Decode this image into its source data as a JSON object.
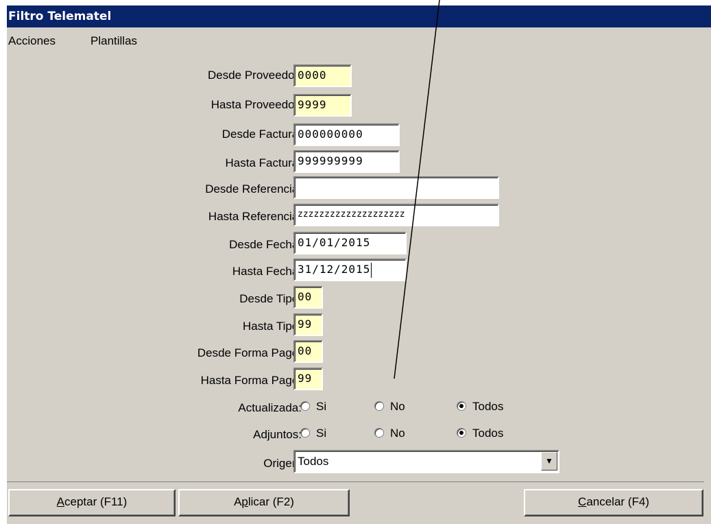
{
  "window": {
    "title": "Filtro Telematel"
  },
  "menu": {
    "items": [
      "Acciones",
      "Plantillas"
    ]
  },
  "form": {
    "fields": [
      {
        "label": "Desde Proveedor:",
        "value": "0000"
      },
      {
        "label": "Hasta Proveedor:",
        "value": "9999"
      },
      {
        "label": "Desde Factura:",
        "value": "000000000"
      },
      {
        "label": "Hasta Factura:",
        "value": "999999999"
      },
      {
        "label": "Desde Referencia:",
        "value": ""
      },
      {
        "label": "Hasta Referencia:",
        "value": "zzzzzzzzzzzzzzzzzzzz"
      },
      {
        "label": "Desde Fecha:",
        "value": "01/01/2015"
      },
      {
        "label": "Hasta Fecha:",
        "value": "31/12/2015"
      },
      {
        "label": "Desde Tipo:",
        "value": "00"
      },
      {
        "label": "Hasta Tipo:",
        "value": "99"
      },
      {
        "label": "Desde Forma Pago:",
        "value": "00"
      },
      {
        "label": "Hasta Forma Pago:",
        "value": "99"
      }
    ],
    "actualizada": {
      "label": "Actualizada:",
      "options": [
        "Si",
        "No",
        "Todos"
      ],
      "selected": "Todos"
    },
    "adjuntos": {
      "label": "Adjuntos:",
      "options": [
        "Si",
        "No",
        "Todos"
      ],
      "selected": "Todos"
    },
    "origen": {
      "label": "Origen:",
      "value": "Todos"
    }
  },
  "buttons": {
    "aceptar": {
      "hotkey": "A",
      "rest": "ceptar (F11)"
    },
    "aplicar": {
      "pre": "A",
      "hotkey": "p",
      "rest": "licar (F2)"
    },
    "cancelar": {
      "hotkey": "C",
      "rest": "ancelar (F4)"
    }
  },
  "colors": {
    "titlebar": "#0a246a",
    "dialog_bg": "#d4d0c8",
    "field_yellow": "#ffffc6",
    "field_white": "#ffffff"
  }
}
